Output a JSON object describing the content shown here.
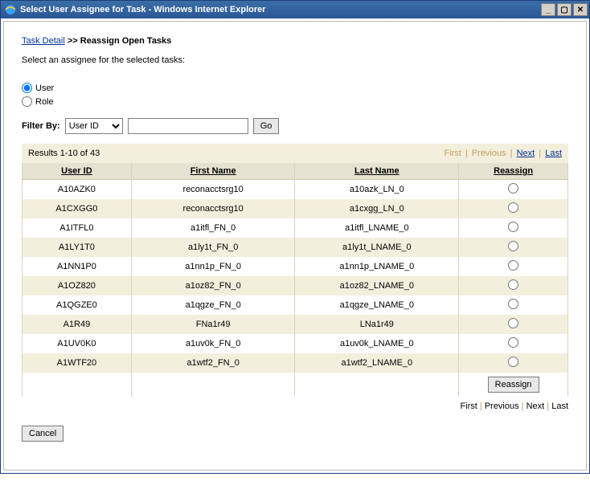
{
  "window": {
    "title": "Select User Assignee for Task - Windows Internet Explorer"
  },
  "breadcrumb": {
    "task_detail": "Task Detail",
    "sep": ">>",
    "current": "Reassign Open Tasks"
  },
  "prompt": "Select an assignee for the selected tasks:",
  "radio": {
    "user": "User",
    "role": "Role"
  },
  "filter": {
    "label": "Filter By:",
    "select": "User ID",
    "input_value": "",
    "go": "Go"
  },
  "results": {
    "summary": "Results 1-10 of 43",
    "first": "First",
    "previous": "Previous",
    "next": "Next",
    "last": "Last"
  },
  "columns": {
    "user_id": "User ID",
    "first_name": "First Name",
    "last_name": "Last Name",
    "reassign": "Reassign"
  },
  "rows": [
    {
      "user_id": "A10AZK0",
      "first_name": "reconacctsrg10",
      "last_name": "a10azk_LN_0"
    },
    {
      "user_id": "A1CXGG0",
      "first_name": "reconacctsrg10",
      "last_name": "a1cxgg_LN_0"
    },
    {
      "user_id": "A1ITFL0",
      "first_name": "a1itfl_FN_0",
      "last_name": "a1itfl_LNAME_0"
    },
    {
      "user_id": "A1LY1T0",
      "first_name": "a1ly1t_FN_0",
      "last_name": "a1ly1t_LNAME_0"
    },
    {
      "user_id": "A1NN1P0",
      "first_name": "a1nn1p_FN_0",
      "last_name": "a1nn1p_LNAME_0"
    },
    {
      "user_id": "A1OZ820",
      "first_name": "a1oz82_FN_0",
      "last_name": "a1oz82_LNAME_0"
    },
    {
      "user_id": "A1QGZE0",
      "first_name": "a1qgze_FN_0",
      "last_name": "a1qgze_LNAME_0"
    },
    {
      "user_id": "A1R49",
      "first_name": "FNa1r49",
      "last_name": "LNa1r49"
    },
    {
      "user_id": "A1UV0K0",
      "first_name": "a1uv0k_FN_0",
      "last_name": "a1uv0k_LNAME_0"
    },
    {
      "user_id": "A1WTF20",
      "first_name": "a1wtf2_FN_0",
      "last_name": "a1wtf2_LNAME_0"
    }
  ],
  "buttons": {
    "reassign": "Reassign",
    "cancel": "Cancel"
  }
}
